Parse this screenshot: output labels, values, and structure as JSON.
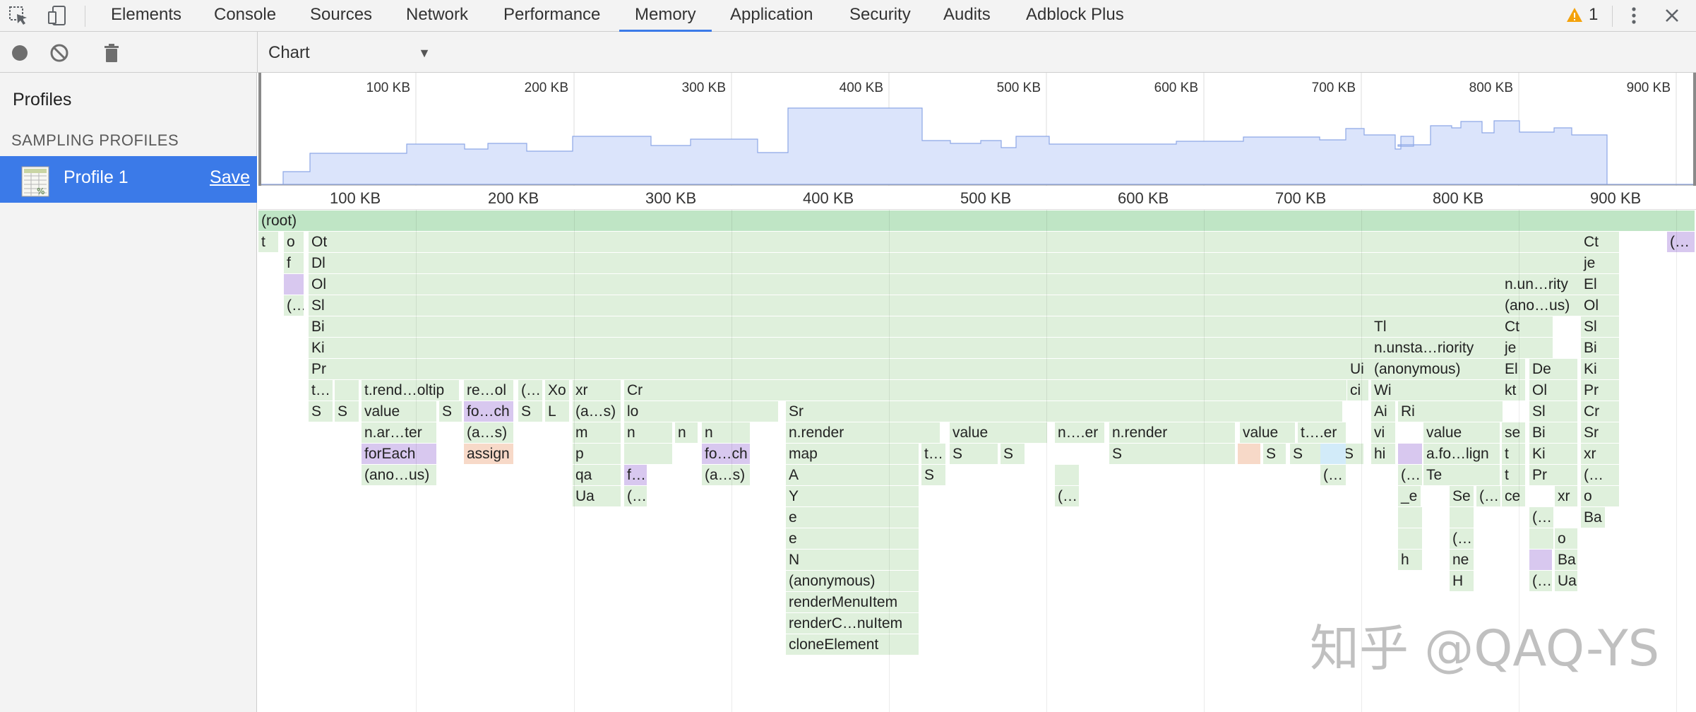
{
  "tabs": [
    "Elements",
    "Console",
    "Sources",
    "Network",
    "Performance",
    "Memory",
    "Application",
    "Security",
    "Audits",
    "Adblock Plus"
  ],
  "selected_tab": "Memory",
  "warning_count": "1",
  "view_select": {
    "value": "Chart",
    "options": [
      "Chart"
    ]
  },
  "sidebar": {
    "title": "Profiles",
    "section": "SAMPLING PROFILES",
    "profile_name": "Profile 1",
    "save_label": "Save"
  },
  "ruler_labels": [
    "100 KB",
    "200 KB",
    "300 KB",
    "400 KB",
    "500 KB",
    "600 KB",
    "700 KB",
    "800 KB",
    "900 KB"
  ],
  "watermark": "知乎 @QAQ-YS",
  "colors": {
    "accent": "#3b7ae8",
    "frame_green": "#dff0dc",
    "frame_root": "#bfe5c5",
    "frame_purple": "#d8c8ef",
    "frame_orange": "#f7d9c8",
    "frame_blue": "#d2ebf9",
    "overview_fill": "#dbe4fb",
    "overview_line": "#8da7e6",
    "warning": "#f4a20b"
  },
  "frames": [
    [
      "(root)",
      0,
      0,
      2036,
      "g"
    ],
    [
      "t",
      1,
      0,
      30,
      "g"
    ],
    [
      "o",
      1,
      36,
      30,
      "g"
    ],
    [
      "Ot",
      1,
      71,
      1808,
      "g"
    ],
    [
      "Ct",
      1,
      1873,
      56,
      "g"
    ],
    [
      "(…",
      1,
      1995,
      41,
      "p"
    ],
    [
      "f",
      2,
      36,
      30,
      "g"
    ],
    [
      "Dl",
      2,
      71,
      1808,
      "g"
    ],
    [
      "je",
      2,
      1873,
      56,
      "g"
    ],
    [
      "",
      3,
      36,
      30,
      "p"
    ],
    [
      "Ol",
      3,
      71,
      1808,
      "g"
    ],
    [
      "n.un…rity",
      3,
      1761,
      108,
      "g"
    ],
    [
      "El",
      3,
      1873,
      56,
      "g"
    ],
    [
      "(…",
      4,
      36,
      30,
      "g"
    ],
    [
      "Sl",
      4,
      71,
      1808,
      "g"
    ],
    [
      "(ano…us)",
      4,
      1761,
      108,
      "g"
    ],
    [
      "Ol",
      4,
      1873,
      56,
      "g"
    ],
    [
      "Bi",
      5,
      71,
      1530,
      "g"
    ],
    [
      "Tl",
      5,
      1576,
      190,
      "g"
    ],
    [
      "Ct",
      5,
      1761,
      74,
      "g"
    ],
    [
      "Sl",
      5,
      1873,
      56,
      "g"
    ],
    [
      "Ki",
      6,
      71,
      1530,
      "g"
    ],
    [
      "n.unsta…riority",
      6,
      1576,
      190,
      "g"
    ],
    [
      "je",
      6,
      1761,
      74,
      "g"
    ],
    [
      "Bi",
      6,
      1873,
      56,
      "g"
    ],
    [
      "Pr",
      7,
      71,
      1530,
      "g"
    ],
    [
      "Ui",
      7,
      1542,
      32,
      "g"
    ],
    [
      "(anonymous)",
      7,
      1576,
      190,
      "g"
    ],
    [
      "El",
      7,
      1761,
      35,
      "g"
    ],
    [
      "De",
      7,
      1800,
      70,
      "g"
    ],
    [
      "Ki",
      7,
      1873,
      56,
      "g"
    ],
    [
      "t…",
      8,
      71,
      36,
      "g"
    ],
    [
      "",
      8,
      108,
      36,
      "g"
    ],
    [
      "t.rend…oltip",
      8,
      146,
      140,
      "g"
    ],
    [
      "re…ol",
      8,
      291,
      72,
      "g"
    ],
    [
      "(…",
      8,
      368,
      36,
      "g"
    ],
    [
      "Xo",
      8,
      406,
      36,
      "g"
    ],
    [
      "xr",
      8,
      445,
      70,
      "g"
    ],
    [
      "Cr",
      8,
      518,
      1025,
      "g"
    ],
    [
      "ci",
      8,
      1542,
      32,
      "g"
    ],
    [
      "Wi",
      8,
      1576,
      190,
      "g"
    ],
    [
      "kt",
      8,
      1761,
      35,
      "g"
    ],
    [
      "Ol",
      8,
      1800,
      70,
      "g"
    ],
    [
      "Pr",
      8,
      1873,
      56,
      "g"
    ],
    [
      "S",
      9,
      71,
      36,
      "g"
    ],
    [
      "S",
      9,
      108,
      36,
      "g"
    ],
    [
      "value",
      9,
      146,
      108,
      "g"
    ],
    [
      "S",
      9,
      256,
      34,
      "g"
    ],
    [
      "fo…ch",
      9,
      291,
      72,
      "p"
    ],
    [
      "S",
      9,
      368,
      36,
      "g"
    ],
    [
      "L",
      9,
      406,
      36,
      "g"
    ],
    [
      "(a…s)",
      9,
      445,
      70,
      "g"
    ],
    [
      "lo",
      9,
      518,
      220,
      "g"
    ],
    [
      "Sr",
      9,
      747,
      790,
      "g"
    ],
    [
      "Ai",
      9,
      1576,
      36,
      "g"
    ],
    [
      "Ri",
      9,
      1614,
      150,
      "g"
    ],
    [
      "Sl",
      9,
      1800,
      70,
      "g"
    ],
    [
      "Cr",
      9,
      1873,
      56,
      "g"
    ],
    [
      "n.ar…ter",
      10,
      146,
      108,
      "g"
    ],
    [
      "(a…s)",
      10,
      291,
      72,
      "g"
    ],
    [
      "m",
      10,
      445,
      70,
      "g"
    ],
    [
      "n",
      10,
      518,
      70,
      "g"
    ],
    [
      "n",
      10,
      590,
      34,
      "g"
    ],
    [
      "n",
      10,
      628,
      70,
      "g"
    ],
    [
      "n.render",
      10,
      747,
      220,
      "g"
    ],
    [
      "value",
      10,
      979,
      140,
      "g"
    ],
    [
      "n….er",
      10,
      1128,
      72,
      "g"
    ],
    [
      "n.render",
      10,
      1205,
      180,
      "g"
    ],
    [
      "value",
      10,
      1390,
      80,
      "g"
    ],
    [
      "t….er",
      10,
      1472,
      70,
      "g"
    ],
    [
      "vi",
      10,
      1576,
      36,
      "g"
    ],
    [
      "value",
      10,
      1650,
      110,
      "g"
    ],
    [
      "se",
      10,
      1761,
      35,
      "g"
    ],
    [
      "Bi",
      10,
      1800,
      70,
      "g"
    ],
    [
      "Sr",
      10,
      1873,
      56,
      "g"
    ],
    [
      "forEach",
      11,
      146,
      108,
      "p"
    ],
    [
      "assign",
      11,
      291,
      72,
      "o"
    ],
    [
      "p",
      11,
      445,
      70,
      "g"
    ],
    [
      "",
      11,
      518,
      70,
      "g"
    ],
    [
      "fo…ch",
      11,
      628,
      70,
      "p"
    ],
    [
      "map",
      11,
      747,
      190,
      "g"
    ],
    [
      "t…",
      11,
      939,
      36,
      "g"
    ],
    [
      "S",
      11,
      979,
      70,
      "g"
    ],
    [
      "S",
      11,
      1051,
      36,
      "g"
    ],
    [
      "S",
      11,
      1205,
      180,
      "g"
    ],
    [
      "",
      11,
      1387,
      34,
      "o"
    ],
    [
      "S",
      11,
      1423,
      34,
      "g"
    ],
    [
      "S",
      11,
      1461,
      70,
      "g"
    ],
    [
      "S",
      11,
      1533,
      34,
      "g"
    ],
    [
      "",
      11,
      1504,
      38,
      "b"
    ],
    [
      "hi",
      11,
      1576,
      36,
      "g"
    ],
    [
      "",
      11,
      1614,
      36,
      "p"
    ],
    [
      "a.fo…lign",
      11,
      1650,
      110,
      "g"
    ],
    [
      "t",
      11,
      1761,
      35,
      "g"
    ],
    [
      "Ki",
      11,
      1800,
      70,
      "g"
    ],
    [
      "xr",
      11,
      1873,
      56,
      "g"
    ],
    [
      "(ano…us)",
      12,
      146,
      108,
      "g"
    ],
    [
      "qa",
      12,
      445,
      70,
      "g"
    ],
    [
      "f…",
      12,
      518,
      34,
      "p"
    ],
    [
      "(a…s)",
      12,
      628,
      70,
      "g"
    ],
    [
      "A",
      12,
      747,
      190,
      "g"
    ],
    [
      "S",
      12,
      939,
      36,
      "g"
    ],
    [
      "",
      12,
      1128,
      36,
      "g"
    ],
    [
      "(…",
      12,
      1504,
      38,
      "g"
    ],
    [
      "(…",
      12,
      1614,
      36,
      "g"
    ],
    [
      "Te",
      12,
      1650,
      110,
      "g"
    ],
    [
      "t",
      12,
      1761,
      35,
      "g"
    ],
    [
      "Pr",
      12,
      1800,
      70,
      "g"
    ],
    [
      "(…",
      12,
      1873,
      56,
      "g"
    ],
    [
      "Ua",
      13,
      445,
      70,
      "g"
    ],
    [
      "(…",
      13,
      518,
      34,
      "g"
    ],
    [
      "Y",
      13,
      747,
      190,
      "g"
    ],
    [
      "(…",
      13,
      1128,
      36,
      "g"
    ],
    [
      "_e",
      13,
      1614,
      34,
      "g"
    ],
    [
      "Se",
      13,
      1687,
      36,
      "g"
    ],
    [
      "(…",
      13,
      1725,
      36,
      "g"
    ],
    [
      "ce",
      13,
      1761,
      35,
      "g"
    ],
    [
      "xr",
      13,
      1836,
      34,
      "g"
    ],
    [
      "o",
      13,
      1873,
      56,
      "g"
    ],
    [
      "e",
      14,
      747,
      190,
      "g"
    ],
    [
      "",
      14,
      1614,
      36,
      "g"
    ],
    [
      "",
      14,
      1687,
      36,
      "g"
    ],
    [
      "(…",
      14,
      1800,
      36,
      "g"
    ],
    [
      "Ba",
      14,
      1873,
      36,
      "g"
    ],
    [
      "e",
      15,
      747,
      190,
      "g"
    ],
    [
      "",
      15,
      1614,
      36,
      "g"
    ],
    [
      "(…",
      15,
      1687,
      36,
      "g"
    ],
    [
      "",
      15,
      1800,
      36,
      "g"
    ],
    [
      "o",
      15,
      1836,
      34,
      "g"
    ],
    [
      "N",
      16,
      747,
      190,
      "g"
    ],
    [
      "h",
      16,
      1614,
      36,
      "g"
    ],
    [
      "ne",
      16,
      1687,
      36,
      "g"
    ],
    [
      "",
      16,
      1800,
      34,
      "p"
    ],
    [
      "Ba",
      16,
      1836,
      34,
      "g"
    ],
    [
      "(anonymous)",
      17,
      747,
      190,
      "g"
    ],
    [
      "H",
      17,
      1687,
      36,
      "g"
    ],
    [
      "(…",
      17,
      1800,
      34,
      "g"
    ],
    [
      "Ua",
      17,
      1836,
      34,
      "g"
    ],
    [
      "renderMenuItem",
      18,
      747,
      190,
      "g"
    ],
    [
      "renderC…nuItem",
      19,
      747,
      190,
      "g"
    ],
    [
      "cloneElement",
      20,
      747,
      190,
      "g"
    ]
  ]
}
